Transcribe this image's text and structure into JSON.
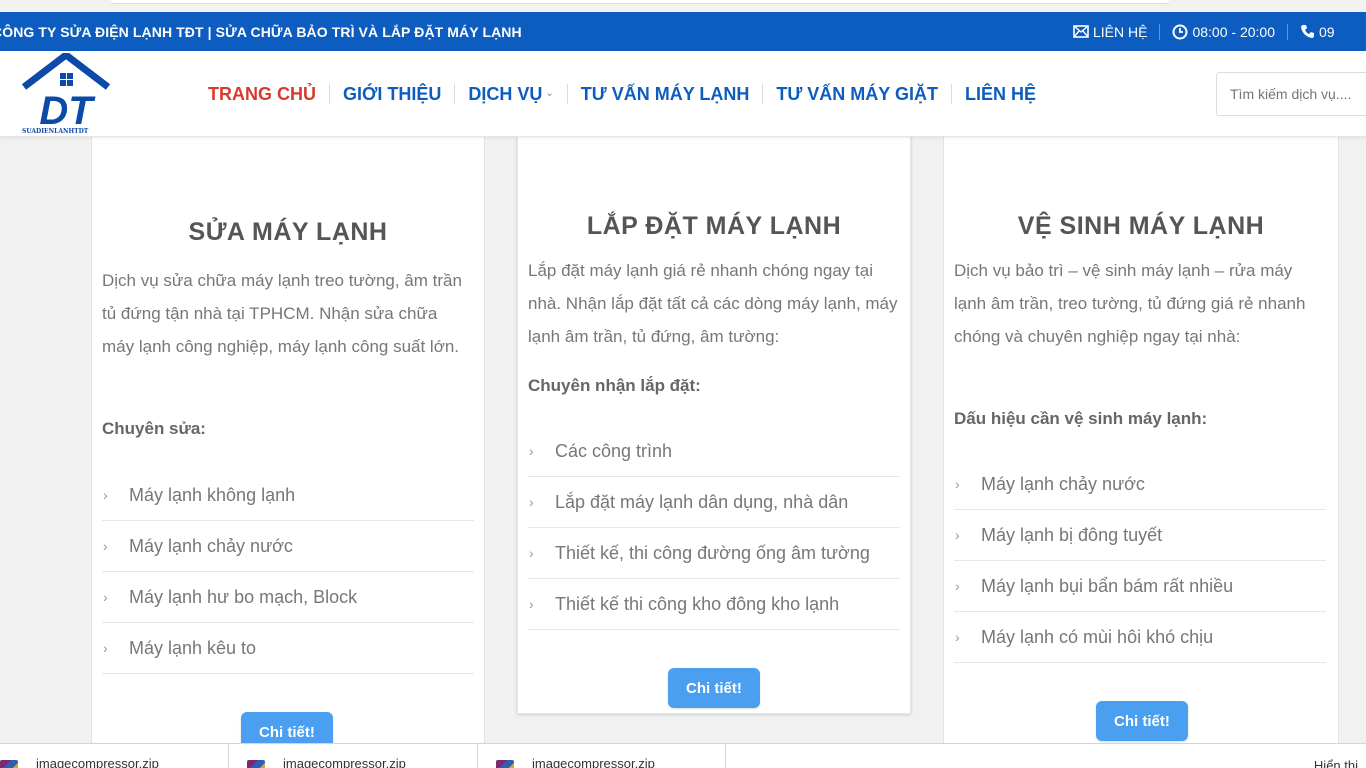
{
  "topbar": {
    "title": "CÔNG TY SỬA ĐIỆN LẠNH TĐT | SỬA CHỮA BẢO TRÌ VÀ LẮP ĐẶT MÁY LẠNH",
    "contact": "LIÊN HỆ",
    "hours": "08:00 - 20:00",
    "phone": "09"
  },
  "logo": {
    "letters": "DT",
    "caption": "SUADIENLANHTDT"
  },
  "nav": {
    "items": [
      "TRANG CHỦ",
      "GIỚI THIỆU",
      "DỊCH VỤ",
      "TƯ VẤN MÁY LẠNH",
      "TƯ VẤN MÁY GIẶT",
      "LIÊN HỆ"
    ]
  },
  "search": {
    "placeholder": "Tìm kiếm dịch vụ...."
  },
  "cards": [
    {
      "title": "SỬA MÁY LẠNH",
      "description": "Dịch vụ sửa chữa máy lạnh treo tường, âm trần tủ đứng tận nhà tại TPHCM. Nhận sửa chữa máy lạnh công nghiệp, máy lạnh công suất lớn.",
      "subheading": "Chuyên sửa:",
      "items": [
        "Máy lạnh không lạnh",
        "Máy lạnh chảy nước",
        "Máy lạnh hư bo mạch, Block",
        "Máy lạnh kêu to"
      ],
      "button": "Chi tiết!"
    },
    {
      "title": "LẮP ĐẶT MÁY LẠNH",
      "description": "Lắp đặt máy lạnh giá rẻ nhanh chóng ngay tại nhà. Nhận lắp đặt tất cả các dòng máy lạnh, máy lạnh âm trần, tủ đứng, âm tường:",
      "subheading": "Chuyên nhận lắp đặt:",
      "items": [
        "Các công trình",
        "Lắp đặt máy lạnh dân dụng,  nhà dân",
        "Thiết kế, thi công đường ống âm tường",
        "Thiết kế thi công kho đông kho lạnh"
      ],
      "button": "Chi tiết!"
    },
    {
      "title": "VỆ SINH MÁY LẠNH",
      "description": "Dịch vụ bảo trì – vệ sinh máy lạnh – rửa máy lạnh âm trần, treo tường, tủ đứng giá rẻ nhanh chóng và chuyên nghiệp ngay tại nhà:",
      "subheading": "Dấu hiệu cần vệ sinh máy lạnh:",
      "items": [
        "Máy lạnh chảy nước",
        "Máy lạnh bị đông tuyết",
        "Máy lạnh bụi bẩn bám rất nhiều",
        "Máy lạnh có mùi hôi khó chịu"
      ],
      "button": "Chi tiết!"
    }
  ],
  "downloads": {
    "files": [
      "imagecompressor.zip",
      "imagecompressor.zip",
      "imagecompressor.zip"
    ],
    "show_all": "Hiển thị"
  },
  "colors": {
    "topbar": "#0c5dbf",
    "nav_active": "#d83a2d",
    "nav": "#0c5dbf",
    "button": "#4a9ff0"
  },
  "icons": {
    "contact": "envelope-icon",
    "hours": "clock-icon",
    "phone": "phone-icon",
    "list_arrow": "chevron-right-icon",
    "dropdown": "chevron-down-icon"
  }
}
